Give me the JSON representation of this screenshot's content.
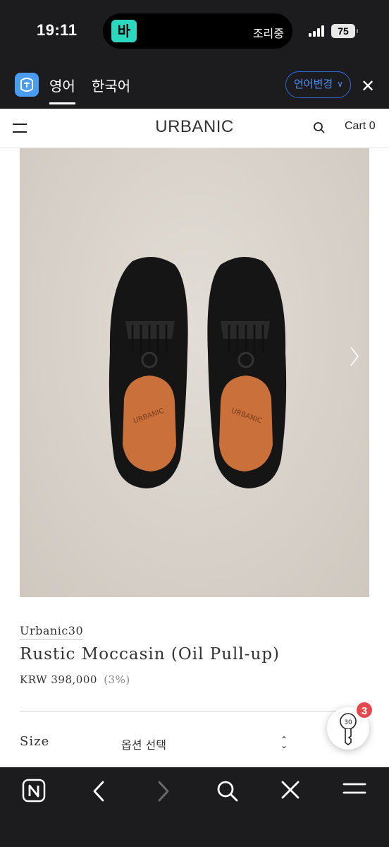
{
  "status_bar": {
    "time": "19:11",
    "activity_app_label": "바",
    "activity_text": "조리중",
    "battery": "75"
  },
  "translate_bar": {
    "active_language": "영어",
    "other_language": "한국어",
    "change_language_label": "언어변경",
    "close_label": "✕"
  },
  "site_header": {
    "brand": "URBANIC",
    "cart_label": "Cart",
    "cart_count": "0"
  },
  "product": {
    "brand_line": "Urbanic30",
    "title": "Rustic Moccasin (Oil Pull-up)",
    "currency": "KRW",
    "price": "398,000",
    "discount": "(3%)",
    "size_label": "Size",
    "size_placeholder": "옵션 선택"
  },
  "floating_button": {
    "badge_count": "3",
    "key_label": "30"
  },
  "colors": {
    "system_bar": "#1c1c1e",
    "accent_blue": "#4f8ef7",
    "badge_red": "#e5484d",
    "photo_background": "#d9d3cb"
  },
  "icons": [
    "menu-icon",
    "search-icon",
    "chevron-right-icon",
    "key-icon",
    "n-logo-icon",
    "back-icon",
    "forward-icon",
    "close-icon",
    "hamburger-icon"
  ]
}
